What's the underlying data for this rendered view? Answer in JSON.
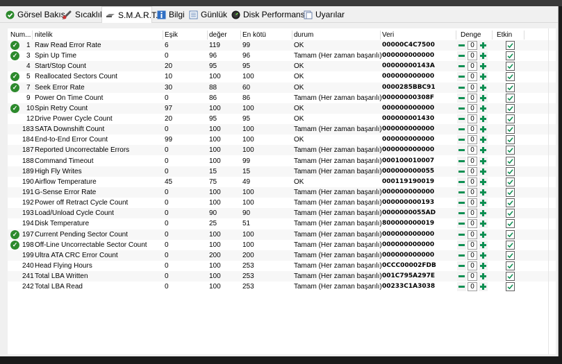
{
  "tabs": [
    {
      "label": "Görsel Bakış",
      "icon": "overview-icon",
      "active": false
    },
    {
      "label": "Sıcaklık",
      "icon": "thermometer-icon",
      "active": false
    },
    {
      "label": "S.M.A.R.T.",
      "icon": "drive-icon",
      "active": true
    },
    {
      "label": "Bilgi",
      "icon": "info-icon",
      "active": false
    },
    {
      "label": "Günlük",
      "icon": "log-icon",
      "active": false
    },
    {
      "label": "Disk Performansı",
      "icon": "speed-icon",
      "active": false
    },
    {
      "label": "Uyarılar",
      "icon": "alert-icon",
      "active": false
    }
  ],
  "columns": {
    "num": "Num...",
    "name": "nitelik",
    "threshold": "Eşik",
    "value": "değer",
    "worst": "En kötü",
    "status": "durum",
    "raw": "Veri",
    "offset": "Denge",
    "enabled": "Etkin"
  },
  "rows": [
    {
      "num": "1",
      "name": "Raw Read Error Rate",
      "threshold": "6",
      "value": "119",
      "worst": "99",
      "status": "OK",
      "raw": "00000C4C7500",
      "offset": "0",
      "check": true
    },
    {
      "num": "3",
      "name": "Spin Up Time",
      "threshold": "0",
      "value": "96",
      "worst": "96",
      "status": "Tamam (Her zaman başarılı)",
      "raw": "000000000000",
      "offset": "0",
      "check": true
    },
    {
      "num": "4",
      "name": "Start/Stop Count",
      "threshold": "20",
      "value": "95",
      "worst": "95",
      "status": "OK",
      "raw": "00000000143A",
      "offset": "0",
      "check": false
    },
    {
      "num": "5",
      "name": "Reallocated Sectors Count",
      "threshold": "10",
      "value": "100",
      "worst": "100",
      "status": "OK",
      "raw": "000000000000",
      "offset": "0",
      "check": true
    },
    {
      "num": "7",
      "name": "Seek Error Rate",
      "threshold": "30",
      "value": "88",
      "worst": "60",
      "status": "OK",
      "raw": "0000285BBC91",
      "offset": "0",
      "check": true
    },
    {
      "num": "9",
      "name": "Power On Time Count",
      "threshold": "0",
      "value": "86",
      "worst": "86",
      "status": "Tamam (Her zaman başarılı)",
      "raw": "00000000308F",
      "offset": "0",
      "check": false
    },
    {
      "num": "10",
      "name": "Spin Retry Count",
      "threshold": "97",
      "value": "100",
      "worst": "100",
      "status": "OK",
      "raw": "000000000000",
      "offset": "0",
      "check": true
    },
    {
      "num": "12",
      "name": "Drive Power Cycle Count",
      "threshold": "20",
      "value": "95",
      "worst": "95",
      "status": "OK",
      "raw": "000000001430",
      "offset": "0",
      "check": false
    },
    {
      "num": "183",
      "name": "SATA Downshift Count",
      "threshold": "0",
      "value": "100",
      "worst": "100",
      "status": "Tamam (Her zaman başarılı)",
      "raw": "000000000000",
      "offset": "0",
      "check": false
    },
    {
      "num": "184",
      "name": "End-to-End Error Count",
      "threshold": "99",
      "value": "100",
      "worst": "100",
      "status": "OK",
      "raw": "000000000000",
      "offset": "0",
      "check": false
    },
    {
      "num": "187",
      "name": "Reported Uncorrectable Errors",
      "threshold": "0",
      "value": "100",
      "worst": "100",
      "status": "Tamam (Her zaman başarılı)",
      "raw": "000000000000",
      "offset": "0",
      "check": false
    },
    {
      "num": "188",
      "name": "Command Timeout",
      "threshold": "0",
      "value": "100",
      "worst": "99",
      "status": "Tamam (Her zaman başarılı)",
      "raw": "000100010007",
      "offset": "0",
      "check": false
    },
    {
      "num": "189",
      "name": "High Fly Writes",
      "threshold": "0",
      "value": "15",
      "worst": "15",
      "status": "Tamam (Her zaman başarılı)",
      "raw": "000000000055",
      "offset": "0",
      "check": false
    },
    {
      "num": "190",
      "name": "Airflow Temperature",
      "threshold": "45",
      "value": "75",
      "worst": "49",
      "status": "OK",
      "raw": "000119190019",
      "offset": "0",
      "check": false
    },
    {
      "num": "191",
      "name": "G-Sense Error Rate",
      "threshold": "0",
      "value": "100",
      "worst": "100",
      "status": "Tamam (Her zaman başarılı)",
      "raw": "000000000000",
      "offset": "0",
      "check": false
    },
    {
      "num": "192",
      "name": "Power off Retract Cycle Count",
      "threshold": "0",
      "value": "100",
      "worst": "100",
      "status": "Tamam (Her zaman başarılı)",
      "raw": "000000000193",
      "offset": "0",
      "check": false
    },
    {
      "num": "193",
      "name": "Load/Unload Cycle Count",
      "threshold": "0",
      "value": "90",
      "worst": "90",
      "status": "Tamam (Her zaman başarılı)",
      "raw": "0000000055AD",
      "offset": "0",
      "check": false
    },
    {
      "num": "194",
      "name": "Disk Temperature",
      "threshold": "0",
      "value": "25",
      "worst": "51",
      "status": "Tamam (Her zaman başarılı)",
      "raw": "800000000019",
      "offset": "0",
      "check": false
    },
    {
      "num": "197",
      "name": "Current Pending Sector Count",
      "threshold": "0",
      "value": "100",
      "worst": "100",
      "status": "Tamam (Her zaman başarılı)",
      "raw": "000000000000",
      "offset": "0",
      "check": true
    },
    {
      "num": "198",
      "name": "Off-Line Uncorrectable Sector Count",
      "threshold": "0",
      "value": "100",
      "worst": "100",
      "status": "Tamam (Her zaman başarılı)",
      "raw": "000000000000",
      "offset": "0",
      "check": true
    },
    {
      "num": "199",
      "name": "Ultra ATA CRC Error Count",
      "threshold": "0",
      "value": "200",
      "worst": "200",
      "status": "Tamam (Her zaman başarılı)",
      "raw": "000000000000",
      "offset": "0",
      "check": false
    },
    {
      "num": "240",
      "name": "Head Flying Hours",
      "threshold": "0",
      "value": "100",
      "worst": "253",
      "status": "Tamam (Her zaman başarılı)",
      "raw": "0CCC00002FDB",
      "offset": "0",
      "check": false
    },
    {
      "num": "241",
      "name": "Total LBA Written",
      "threshold": "0",
      "value": "100",
      "worst": "253",
      "status": "Tamam (Her zaman başarılı)",
      "raw": "001C795A297E",
      "offset": "0",
      "check": false
    },
    {
      "num": "242",
      "name": "Total LBA Read",
      "threshold": "0",
      "value": "100",
      "worst": "253",
      "status": "Tamam (Her zaman başarılı)",
      "raw": "00233C1A3038",
      "offset": "0",
      "check": false
    }
  ],
  "colors": {
    "ok_green": "#2d8a2d",
    "stepper_green": "#0d8f52"
  }
}
